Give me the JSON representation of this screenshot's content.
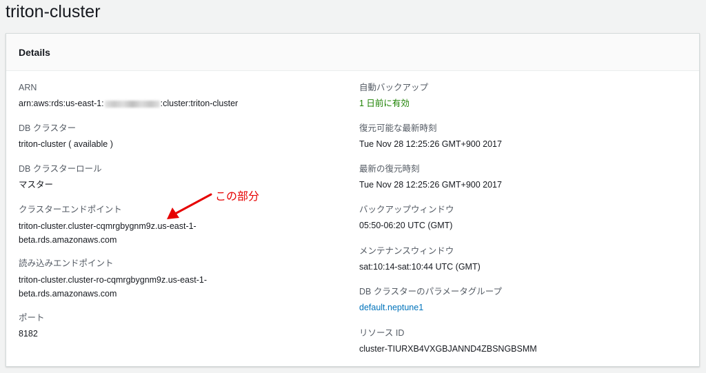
{
  "page": {
    "title": "triton-cluster"
  },
  "details": {
    "heading": "Details",
    "left": {
      "arn": {
        "label": "ARN",
        "prefix": "arn:aws:rds:us-east-1:",
        "suffix": ":cluster:triton-cluster"
      },
      "db_cluster": {
        "label": "DB クラスター",
        "value": "triton-cluster ( available )"
      },
      "db_cluster_role": {
        "label": "DB クラスターロール",
        "value": "マスター"
      },
      "cluster_endpoint": {
        "label": "クラスターエンドポイント",
        "line1": "triton-cluster.cluster-cqmrgbygnm9z.us-east-1-",
        "line2": "beta.rds.amazonaws.com"
      },
      "reader_endpoint": {
        "label": "読み込みエンドポイント",
        "line1": "triton-cluster.cluster-ro-cqmrgbygnm9z.us-east-1-",
        "line2": "beta.rds.amazonaws.com"
      },
      "port": {
        "label": "ポート",
        "value": "8182"
      }
    },
    "right": {
      "auto_backup": {
        "label": "自動バックアップ",
        "value": "1 日前に有効"
      },
      "latest_restorable": {
        "label": "復元可能な最新時刻",
        "value": "Tue Nov 28 12:25:26 GMT+900 2017"
      },
      "latest_restore": {
        "label": "最新の復元時刻",
        "value": "Tue Nov 28 12:25:26 GMT+900 2017"
      },
      "backup_window": {
        "label": "バックアップウィンドウ",
        "value": "05:50-06:20 UTC (GMT)"
      },
      "maintenance_window": {
        "label": "メンテナンスウィンドウ",
        "value": "sat:10:14-sat:10:44 UTC (GMT)"
      },
      "param_group": {
        "label": "DB クラスターのパラメータグループ",
        "value": "default.neptune1"
      },
      "resource_id": {
        "label": "リソース ID",
        "value": "cluster-TIURXB4VXGBJANND4ZBSNGBSMM"
      }
    }
  },
  "annotation": {
    "text": "この部分",
    "color": "#e60000"
  },
  "colors": {
    "link": "#0073bb",
    "success": "#1d8102",
    "label": "#545b64"
  },
  "icons": {
    "annotation_arrow": "red-arrow-icon"
  }
}
